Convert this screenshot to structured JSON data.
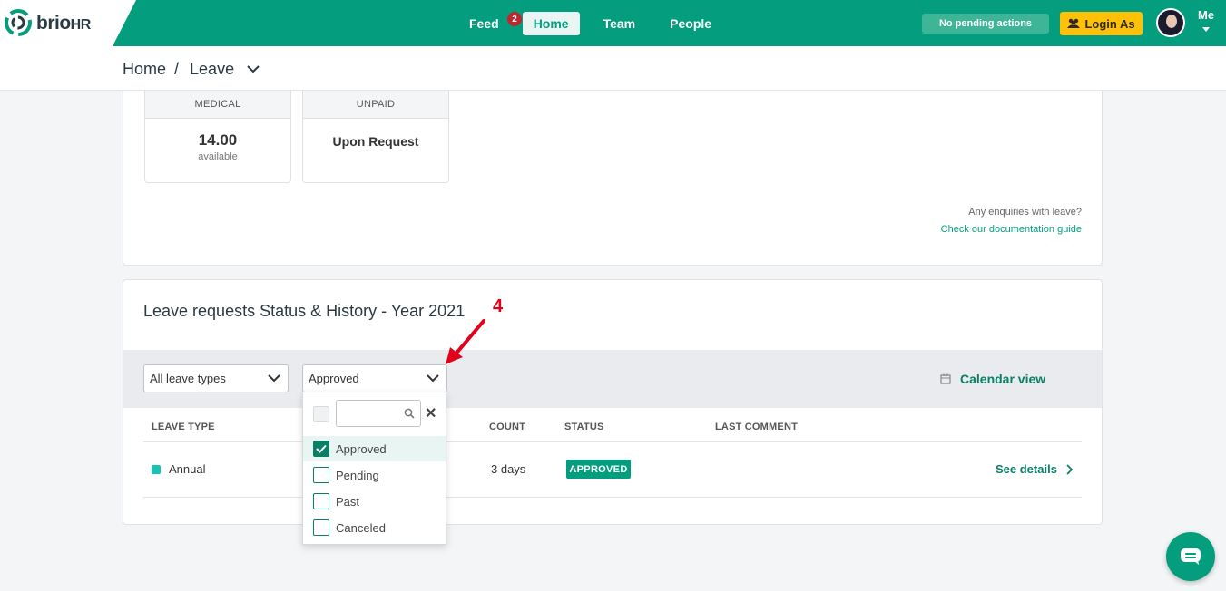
{
  "brand": {
    "name": "brio",
    "suffix": "HR",
    "accent": "#049e7f"
  },
  "nav": {
    "feed": "Feed",
    "feed_badge": "2",
    "home": "Home",
    "team": "Team",
    "people": "People"
  },
  "header": {
    "pending": "No pending actions",
    "login_as": "Login As",
    "me": "Me"
  },
  "breadcrumb": {
    "home": "Home",
    "separator": "/",
    "current": "Leave"
  },
  "balances": [
    {
      "label": "MEDICAL",
      "value": "14.00",
      "sub": "available"
    },
    {
      "label": "UNPAID",
      "value": "Upon Request"
    }
  ],
  "help": {
    "question": "Any enquiries with leave?",
    "link": "Check our documentation guide"
  },
  "requests": {
    "title": "Leave requests Status & History - Year 2021",
    "annotation": "4",
    "filter_type": "All leave types",
    "filter_status": "Approved",
    "calendar": "Calendar view",
    "columns": [
      "LEAVE TYPE",
      "COUNT",
      "STATUS",
      "LAST COMMENT"
    ],
    "rows": [
      {
        "type": "Annual",
        "count": "3 days",
        "status": "APPROVED",
        "action": "See details"
      }
    ]
  },
  "dropdown": {
    "search_placeholder": "",
    "options": [
      {
        "label": "Approved",
        "checked": true
      },
      {
        "label": "Pending",
        "checked": false
      },
      {
        "label": "Past",
        "checked": false
      },
      {
        "label": "Canceled",
        "checked": false
      }
    ]
  }
}
